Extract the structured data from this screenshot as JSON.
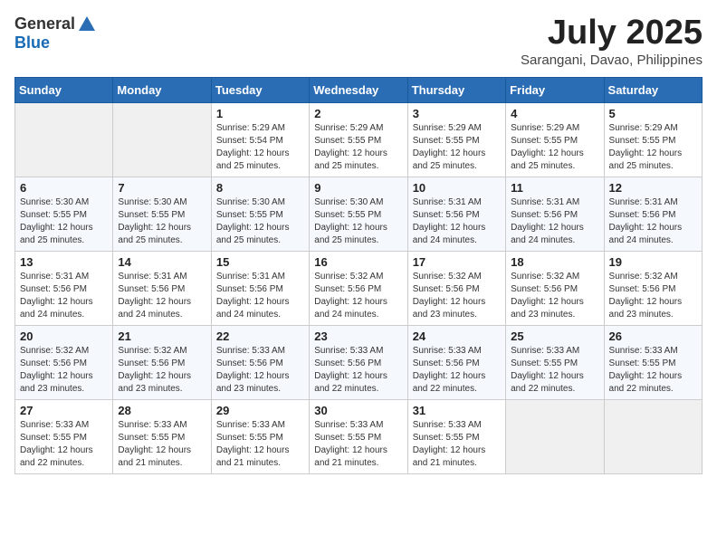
{
  "logo": {
    "general": "General",
    "blue": "Blue"
  },
  "title": {
    "month_year": "July 2025",
    "location": "Sarangani, Davao, Philippines"
  },
  "headers": [
    "Sunday",
    "Monday",
    "Tuesday",
    "Wednesday",
    "Thursday",
    "Friday",
    "Saturday"
  ],
  "weeks": [
    [
      {
        "day": "",
        "info": ""
      },
      {
        "day": "",
        "info": ""
      },
      {
        "day": "1",
        "info": "Sunrise: 5:29 AM\nSunset: 5:54 PM\nDaylight: 12 hours and 25 minutes."
      },
      {
        "day": "2",
        "info": "Sunrise: 5:29 AM\nSunset: 5:55 PM\nDaylight: 12 hours and 25 minutes."
      },
      {
        "day": "3",
        "info": "Sunrise: 5:29 AM\nSunset: 5:55 PM\nDaylight: 12 hours and 25 minutes."
      },
      {
        "day": "4",
        "info": "Sunrise: 5:29 AM\nSunset: 5:55 PM\nDaylight: 12 hours and 25 minutes."
      },
      {
        "day": "5",
        "info": "Sunrise: 5:29 AM\nSunset: 5:55 PM\nDaylight: 12 hours and 25 minutes."
      }
    ],
    [
      {
        "day": "6",
        "info": "Sunrise: 5:30 AM\nSunset: 5:55 PM\nDaylight: 12 hours and 25 minutes."
      },
      {
        "day": "7",
        "info": "Sunrise: 5:30 AM\nSunset: 5:55 PM\nDaylight: 12 hours and 25 minutes."
      },
      {
        "day": "8",
        "info": "Sunrise: 5:30 AM\nSunset: 5:55 PM\nDaylight: 12 hours and 25 minutes."
      },
      {
        "day": "9",
        "info": "Sunrise: 5:30 AM\nSunset: 5:55 PM\nDaylight: 12 hours and 25 minutes."
      },
      {
        "day": "10",
        "info": "Sunrise: 5:31 AM\nSunset: 5:56 PM\nDaylight: 12 hours and 24 minutes."
      },
      {
        "day": "11",
        "info": "Sunrise: 5:31 AM\nSunset: 5:56 PM\nDaylight: 12 hours and 24 minutes."
      },
      {
        "day": "12",
        "info": "Sunrise: 5:31 AM\nSunset: 5:56 PM\nDaylight: 12 hours and 24 minutes."
      }
    ],
    [
      {
        "day": "13",
        "info": "Sunrise: 5:31 AM\nSunset: 5:56 PM\nDaylight: 12 hours and 24 minutes."
      },
      {
        "day": "14",
        "info": "Sunrise: 5:31 AM\nSunset: 5:56 PM\nDaylight: 12 hours and 24 minutes."
      },
      {
        "day": "15",
        "info": "Sunrise: 5:31 AM\nSunset: 5:56 PM\nDaylight: 12 hours and 24 minutes."
      },
      {
        "day": "16",
        "info": "Sunrise: 5:32 AM\nSunset: 5:56 PM\nDaylight: 12 hours and 24 minutes."
      },
      {
        "day": "17",
        "info": "Sunrise: 5:32 AM\nSunset: 5:56 PM\nDaylight: 12 hours and 23 minutes."
      },
      {
        "day": "18",
        "info": "Sunrise: 5:32 AM\nSunset: 5:56 PM\nDaylight: 12 hours and 23 minutes."
      },
      {
        "day": "19",
        "info": "Sunrise: 5:32 AM\nSunset: 5:56 PM\nDaylight: 12 hours and 23 minutes."
      }
    ],
    [
      {
        "day": "20",
        "info": "Sunrise: 5:32 AM\nSunset: 5:56 PM\nDaylight: 12 hours and 23 minutes."
      },
      {
        "day": "21",
        "info": "Sunrise: 5:32 AM\nSunset: 5:56 PM\nDaylight: 12 hours and 23 minutes."
      },
      {
        "day": "22",
        "info": "Sunrise: 5:33 AM\nSunset: 5:56 PM\nDaylight: 12 hours and 23 minutes."
      },
      {
        "day": "23",
        "info": "Sunrise: 5:33 AM\nSunset: 5:56 PM\nDaylight: 12 hours and 22 minutes."
      },
      {
        "day": "24",
        "info": "Sunrise: 5:33 AM\nSunset: 5:56 PM\nDaylight: 12 hours and 22 minutes."
      },
      {
        "day": "25",
        "info": "Sunrise: 5:33 AM\nSunset: 5:55 PM\nDaylight: 12 hours and 22 minutes."
      },
      {
        "day": "26",
        "info": "Sunrise: 5:33 AM\nSunset: 5:55 PM\nDaylight: 12 hours and 22 minutes."
      }
    ],
    [
      {
        "day": "27",
        "info": "Sunrise: 5:33 AM\nSunset: 5:55 PM\nDaylight: 12 hours and 22 minutes."
      },
      {
        "day": "28",
        "info": "Sunrise: 5:33 AM\nSunset: 5:55 PM\nDaylight: 12 hours and 21 minutes."
      },
      {
        "day": "29",
        "info": "Sunrise: 5:33 AM\nSunset: 5:55 PM\nDaylight: 12 hours and 21 minutes."
      },
      {
        "day": "30",
        "info": "Sunrise: 5:33 AM\nSunset: 5:55 PM\nDaylight: 12 hours and 21 minutes."
      },
      {
        "day": "31",
        "info": "Sunrise: 5:33 AM\nSunset: 5:55 PM\nDaylight: 12 hours and 21 minutes."
      },
      {
        "day": "",
        "info": ""
      },
      {
        "day": "",
        "info": ""
      }
    ]
  ]
}
